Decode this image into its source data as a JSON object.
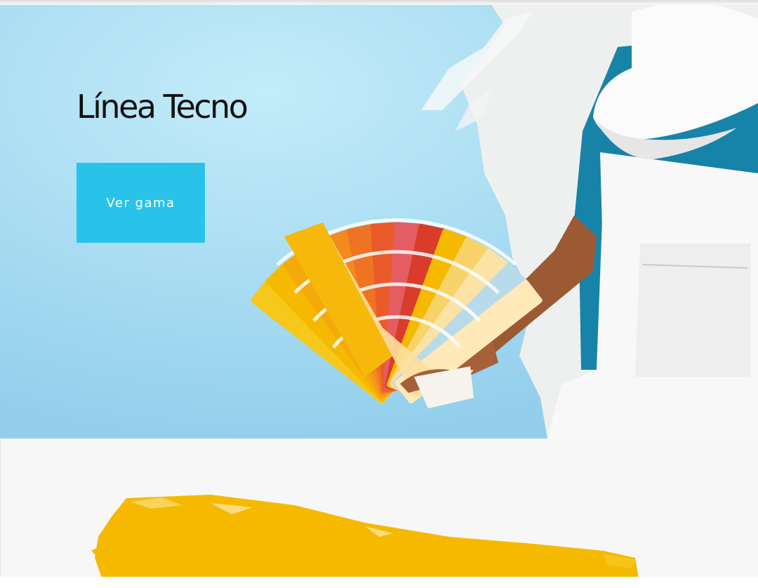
{
  "hero": {
    "title": "Línea Tecno",
    "button_label": "Ver gama",
    "image": {
      "subject": "painter in white cap and overalls holding an orange-yellow paint color fan deck against a light blue wall",
      "icon": "hero-photo"
    }
  },
  "section_two": {
    "image": {
      "subject": "yellow paint roller stroke",
      "icon": "paint-stroke-image"
    }
  },
  "colors": {
    "accent": "#29c3e9",
    "wall_blue": "#a8dbf1",
    "paint_yellow": "#f5b800",
    "section_background": "#f7f7f7"
  }
}
